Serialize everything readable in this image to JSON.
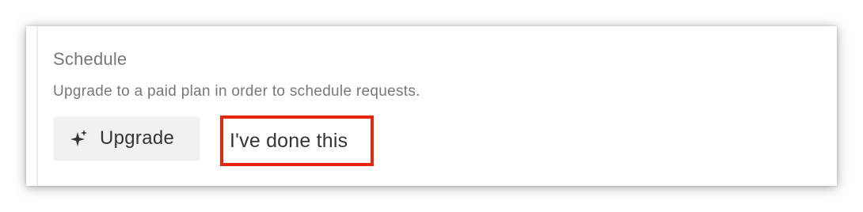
{
  "schedule": {
    "title": "Schedule",
    "description": "Upgrade to a paid plan in order to schedule requests.",
    "upgrade_label": "Upgrade",
    "upgrade_icon": "sparkle-icon",
    "done_label": "I've done this",
    "highlight_color": "#e8270f"
  }
}
